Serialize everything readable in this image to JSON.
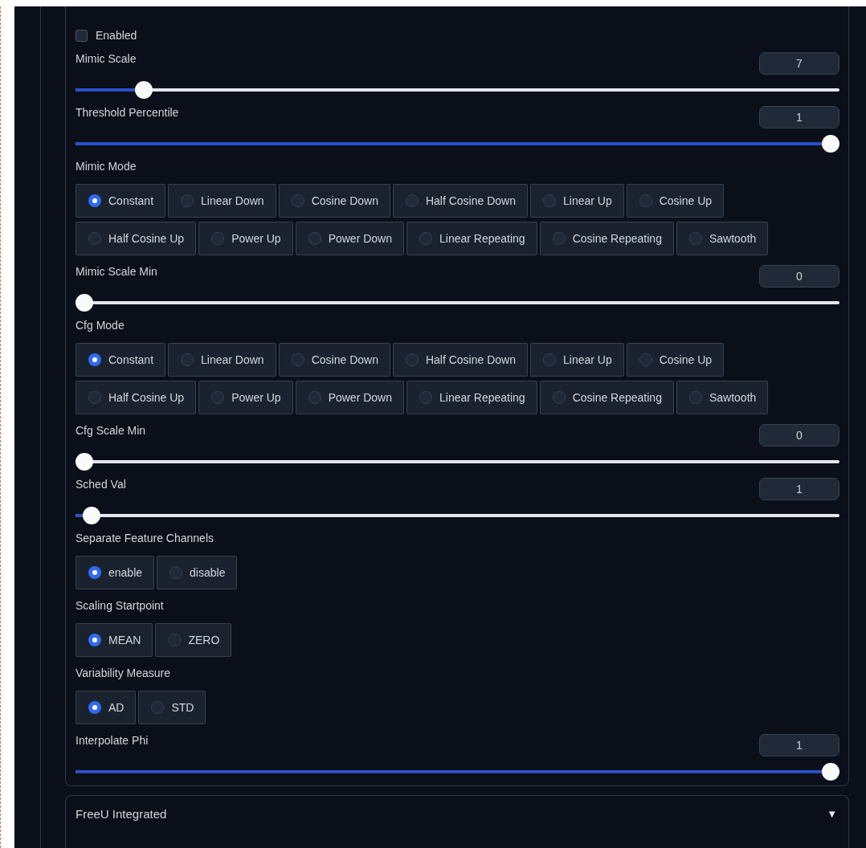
{
  "panel": {
    "controls": [
      {
        "kind": "checkbox",
        "label": "Enabled",
        "checked": false
      },
      {
        "kind": "slider",
        "label": "Mimic Scale",
        "value": "7",
        "level": 0.08
      },
      {
        "kind": "slider",
        "label": "Threshold Percentile",
        "value": "1",
        "level": 1
      },
      {
        "kind": "radio",
        "label": "Mimic Mode",
        "option_rows": [
          [
            {
              "label": "Constant",
              "selected": true
            },
            {
              "label": "Linear Down",
              "selected": false
            },
            {
              "label": "Cosine Down",
              "selected": false
            },
            {
              "label": "Half Cosine Down",
              "selected": false
            },
            {
              "label": "Linear Up",
              "selected": false
            },
            {
              "label": "Cosine Up",
              "selected": false
            }
          ],
          [
            {
              "label": "Half Cosine Up",
              "selected": false
            },
            {
              "label": "Power Up",
              "selected": false
            },
            {
              "label": "Power Down",
              "selected": false
            },
            {
              "label": "Linear Repeating",
              "selected": false
            },
            {
              "label": "Cosine Repeating",
              "selected": false
            },
            {
              "label": "Sawtooth",
              "selected": false
            }
          ]
        ]
      },
      {
        "kind": "slider",
        "label": "Mimic Scale Min",
        "value": "0",
        "level": 0
      },
      {
        "kind": "radio",
        "label": "Cfg Mode",
        "option_rows": [
          [
            {
              "label": "Constant",
              "selected": true
            },
            {
              "label": "Linear Down",
              "selected": false
            },
            {
              "label": "Cosine Down",
              "selected": false
            },
            {
              "label": "Half Cosine Down",
              "selected": false
            },
            {
              "label": "Linear Up",
              "selected": false
            },
            {
              "label": "Cosine Up",
              "selected": false
            }
          ],
          [
            {
              "label": "Half Cosine Up",
              "selected": false
            },
            {
              "label": "Power Up",
              "selected": false
            },
            {
              "label": "Power Down",
              "selected": false
            },
            {
              "label": "Linear Repeating",
              "selected": false
            },
            {
              "label": "Cosine Repeating",
              "selected": false
            },
            {
              "label": "Sawtooth",
              "selected": false
            }
          ]
        ]
      },
      {
        "kind": "slider",
        "label": "Cfg Scale Min",
        "value": "0",
        "level": 0
      },
      {
        "kind": "slider",
        "label": "Sched Val",
        "value": "1",
        "level": 0.01
      },
      {
        "kind": "radio",
        "label": "Separate Feature Channels",
        "option_rows": [
          [
            {
              "label": "enable",
              "selected": true
            },
            {
              "label": "disable",
              "selected": false
            }
          ]
        ]
      },
      {
        "kind": "radio",
        "label": "Scaling Startpoint",
        "option_rows": [
          [
            {
              "label": "MEAN",
              "selected": true
            },
            {
              "label": "ZERO",
              "selected": false
            }
          ]
        ]
      },
      {
        "kind": "radio",
        "label": "Variability Measure",
        "option_rows": [
          [
            {
              "label": "AD",
              "selected": true
            },
            {
              "label": "STD",
              "selected": false
            }
          ]
        ]
      },
      {
        "kind": "slider",
        "label": "Interpolate Phi",
        "value": "1",
        "level": 1
      }
    ]
  },
  "next_panel": {
    "title": "FreeU Integrated",
    "toggle": "▼"
  }
}
